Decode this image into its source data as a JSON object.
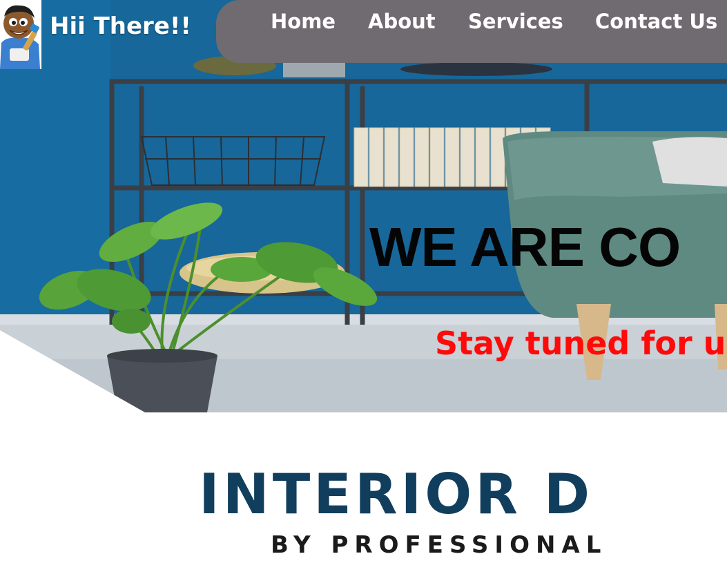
{
  "header": {
    "site_title": "Hii There!!",
    "logo_icon": "painter-mascot-icon"
  },
  "nav": {
    "items": [
      {
        "label": "Home"
      },
      {
        "label": "About"
      },
      {
        "label": "Services"
      },
      {
        "label": "Contact Us"
      }
    ]
  },
  "hero": {
    "headline": "WE ARE CO",
    "subline": "Stay tuned for up"
  },
  "brand": {
    "title": "INTERIOR D",
    "subtitle": "BY PROFESSIONAL"
  },
  "colors": {
    "nav_background": "#706b70",
    "subline_red": "#ff0a0a",
    "brand_navy": "#123e5e",
    "wall_blue": "#1a6a96"
  }
}
